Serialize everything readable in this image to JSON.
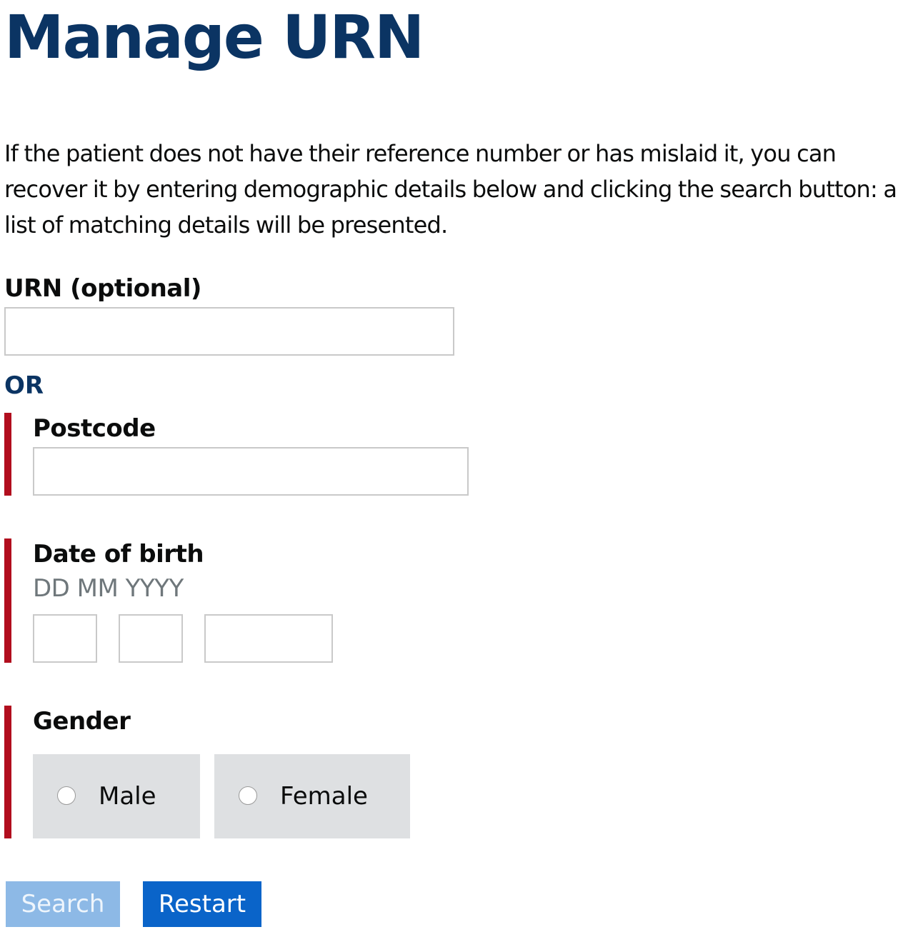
{
  "page": {
    "title": "Manage URN",
    "intro": "If the patient does not have their reference number or has mislaid it, you can recover it by entering demographic details below and clicking the search button: a list of matching details will be presented."
  },
  "urn": {
    "label": "URN (optional)",
    "value": ""
  },
  "or_text": "OR",
  "postcode": {
    "label": "Postcode",
    "value": ""
  },
  "date_of_birth": {
    "label": "Date of birth",
    "hint": "DD MM YYYY",
    "day": "",
    "month": "",
    "year": ""
  },
  "gender": {
    "label": "Gender",
    "options": [
      {
        "label": "Male",
        "selected": false
      },
      {
        "label": "Female",
        "selected": false
      }
    ]
  },
  "actions": {
    "search_label": "Search",
    "search_enabled": false,
    "restart_label": "Restart"
  },
  "colors": {
    "heading": "#0b3463",
    "error_bar": "#b10e1e",
    "button_primary": "#0a64c9",
    "button_disabled": "#8db9e6",
    "radio_background": "#dee0e2"
  }
}
